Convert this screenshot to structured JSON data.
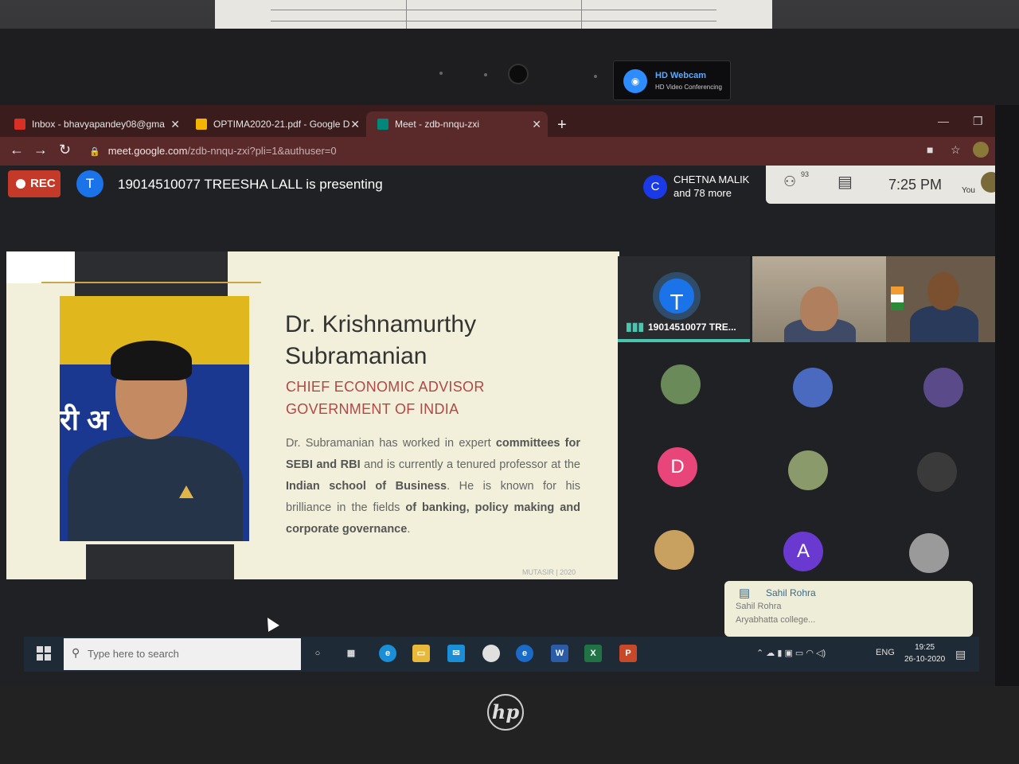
{
  "browser": {
    "tabs": [
      {
        "title": "Inbox - bhavyapandey08@gma",
        "favicon_color": "#d93025"
      },
      {
        "title": "OPTIMA2020-21.pdf - Google D",
        "favicon_color": "#f4b400"
      },
      {
        "title": "Meet - zdb-nnqu-zxi",
        "favicon_color": "#00897b"
      }
    ],
    "url_domain": "meet.google.com",
    "url_path": "/zdb-nnqu-zxi?pli=1&authuser=0"
  },
  "webcam_badge": {
    "title": "HD Webcam",
    "subtitle": "HD Video Conferencing"
  },
  "meet": {
    "rec_label": "REC",
    "presenter_initial": "T",
    "presenting_text": "19014510077 TREESHA LALL is presenting",
    "other_initial": "C",
    "other_name": "CHETNA MALIK",
    "other_more": "and 78 more",
    "people_count": "93",
    "time": "7:25 PM",
    "you_label": "You"
  },
  "slide": {
    "name_line1": "Dr. Krishnamurthy",
    "name_line2": "Subramanian",
    "role_line1": "CHIEF ECONOMIC ADVISOR",
    "role_line2": "GOVERNMENT OF INDIA",
    "desc": [
      {
        "t": "Dr. Subramanian has worked in expert "
      },
      {
        "b": "committees"
      },
      {
        "b": " for SEBI and RBI"
      },
      {
        "t": " and is currently a tenured professor at the "
      },
      {
        "b": "Indian school of Business"
      },
      {
        "t": ". He is known for his brilliance in the fields "
      },
      {
        "b": "of banking, policy making and corporate governance"
      },
      {
        "t": "."
      }
    ],
    "footer": "MUTASIR | 2020",
    "photo_text": "री अ"
  },
  "participants": {
    "main_initial": "T",
    "main_name": "19014510077 TRE..."
  },
  "grid_letters": {
    "d": "D",
    "a": "A"
  },
  "toast": {
    "sender": "Sahil Rohra",
    "line1": "Sahil Rohra",
    "line2": "Aryabhatta college..."
  },
  "taskbar": {
    "search_placeholder": "Type here to search",
    "lang": "ENG",
    "clock_time": "19:25",
    "clock_date": "26-10-2020"
  },
  "colors": {
    "rec": "#c53929",
    "accent": "#1a73e8",
    "speaking": "#48c6b0",
    "role": "#b04848"
  }
}
